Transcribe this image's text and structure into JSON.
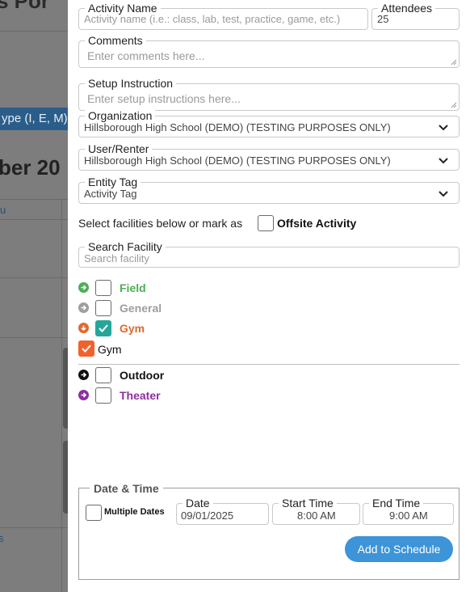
{
  "background": {
    "title_fragment": "s Por",
    "type_filter": "ype (I, E, M)",
    "month_fragment": "ber 20",
    "column_label": "u",
    "bottom_label": "s"
  },
  "form": {
    "activity_name": {
      "label": "Activity Name",
      "placeholder": "Activity name (i.e.: class, lab, test, practice, game, etc.)"
    },
    "attendees": {
      "label": "Attendees",
      "value": "25"
    },
    "comments": {
      "label": "Comments",
      "placeholder": "Enter comments here..."
    },
    "setup": {
      "label": "Setup Instruction",
      "placeholder": "Enter setup instructions here..."
    },
    "organization": {
      "label": "Organization",
      "value": "Hillsborough High School (DEMO) (TESTING PURPOSES ONLY)"
    },
    "user_renter": {
      "label": "User/Renter",
      "value": "Hillsborough High School (DEMO) (TESTING PURPOSES ONLY)"
    },
    "entity_tag": {
      "label": "Entity Tag",
      "value": "Activity Tag"
    },
    "select_text": "Select facilities below or mark as",
    "offsite_label": "Offsite Activity",
    "search_facility": {
      "label": "Search Facility",
      "placeholder": "Search facility"
    }
  },
  "facilities": [
    {
      "name": "Field",
      "color": "#4caf50",
      "icon": "arrow-right-circle-icon",
      "checked": false
    },
    {
      "name": "General",
      "color": "#9e9e9e",
      "icon": "arrow-right-circle-icon",
      "checked": false
    },
    {
      "name": "Gym",
      "color": "#e0682e",
      "icon": "arrow-down-circle-icon",
      "checked": true
    },
    {
      "name": "Outdoor",
      "color": "#111111",
      "icon": "arrow-right-circle-icon",
      "checked": false
    },
    {
      "name": "Theater",
      "color": "#8e2f9e",
      "icon": "arrow-right-circle-icon",
      "checked": false
    }
  ],
  "sub_facilities": [
    {
      "name": "Gym",
      "checked": true
    }
  ],
  "datetime": {
    "legend": "Date & Time",
    "multiple_dates": "Multiple Dates",
    "date": {
      "label": "Date",
      "value": "09/01/2025"
    },
    "start": {
      "label": "Start Time",
      "value": "8:00 AM"
    },
    "end": {
      "label": "End Time",
      "value": "9:00 AM"
    },
    "add_button": "Add to Schedule"
  },
  "colors": {
    "accent": "#3d94d8",
    "checked_teal": "#26a69a",
    "checked_orange": "#f0622c"
  }
}
